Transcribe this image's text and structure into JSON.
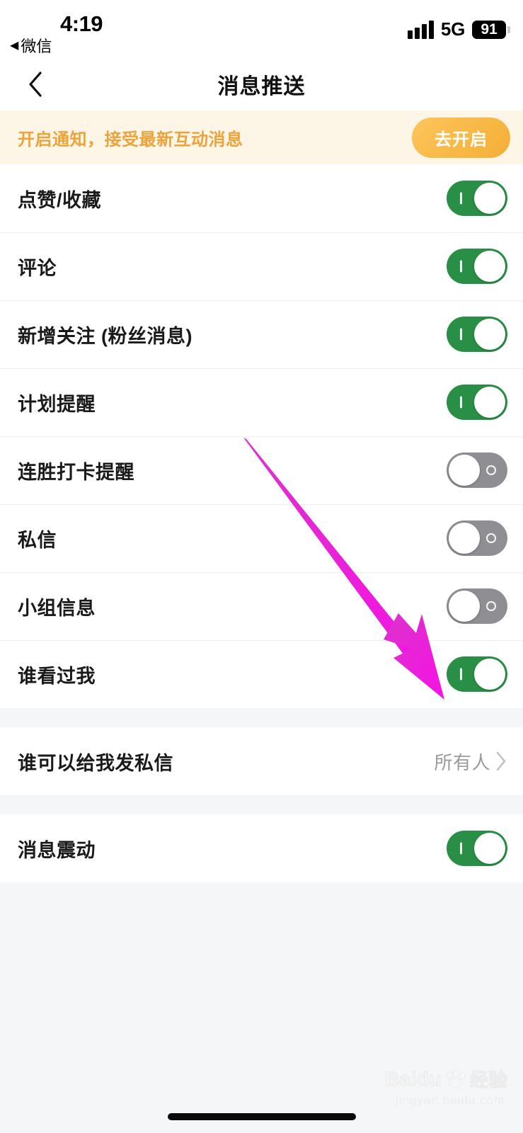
{
  "status_bar": {
    "time": "4:19",
    "back_app_label": "微信",
    "back_app_arrow": "◀",
    "network": "5G",
    "battery_level": "91",
    "signal_icon": "signal-bars-icon"
  },
  "nav": {
    "title": "消息推送",
    "back_icon": "chevron-left-icon"
  },
  "banner": {
    "text": "开启通知，接受最新互动消息",
    "button_label": "去开启",
    "bg_color": "#fdf6e7",
    "text_color": "#eca33c",
    "button_color": "#f5ae36"
  },
  "colors": {
    "switch_on": "#2a8f46",
    "switch_off": "#8e8e93",
    "annotation_arrow": "#ee22cc",
    "page_bg": "#f5f6f7",
    "row_bg": "#ffffff"
  },
  "sections": [
    {
      "rows": [
        {
          "label": "点赞/收藏",
          "type": "switch",
          "state": "on"
        },
        {
          "label": "评论",
          "type": "switch",
          "state": "on"
        },
        {
          "label": "新增关注 (粉丝消息)",
          "type": "switch",
          "state": "on"
        },
        {
          "label": "计划提醒",
          "type": "switch",
          "state": "on"
        },
        {
          "label": "连胜打卡提醒",
          "type": "switch",
          "state": "off"
        },
        {
          "label": "私信",
          "type": "switch",
          "state": "off"
        },
        {
          "label": "小组信息",
          "type": "switch",
          "state": "off"
        },
        {
          "label": "谁看过我",
          "type": "switch",
          "state": "on"
        }
      ]
    },
    {
      "rows": [
        {
          "label": "谁可以给我发私信",
          "type": "value",
          "value": "所有人",
          "chevron_icon": "chevron-right-icon"
        }
      ]
    },
    {
      "rows": [
        {
          "label": "消息震动",
          "type": "switch",
          "state": "on"
        }
      ]
    }
  ],
  "annotation": {
    "arrow_icon": "annotation-arrow-icon",
    "points_at": "谁看过我"
  },
  "watermark": {
    "brand": "Baidu",
    "suffix": "经验",
    "url": "jingyan.baidu.com",
    "paw_icon": "baidu-paw-icon"
  },
  "home_indicator": {
    "icon": "home-indicator-bar"
  }
}
